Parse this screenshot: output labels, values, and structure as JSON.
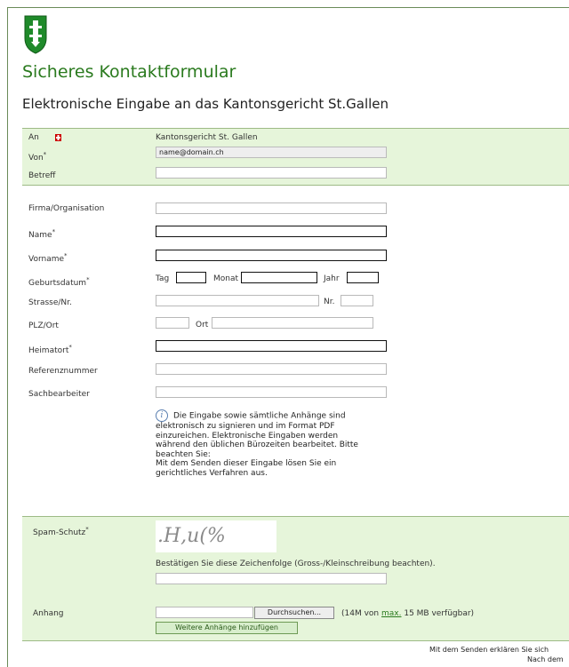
{
  "page": {
    "title": "Sicheres Kontaktformular",
    "subtitle": "Elektronische Eingabe an das Kantonsgericht St.Gallen"
  },
  "header_fields": {
    "an_label": "An",
    "an_value": "Kantonsgericht St. Gallen",
    "von_label": "Von",
    "von_value": "name@domain.ch",
    "betreff_label": "Betreff",
    "betreff_value": ""
  },
  "fields": {
    "firma_label": "Firma/Organisation",
    "name_label": "Name",
    "vorname_label": "Vorname",
    "geburtsdatum_label": "Geburtsdatum",
    "tag_label": "Tag",
    "monat_label": "Monat",
    "jahr_label": "Jahr",
    "strasse_label": "Strasse/Nr.",
    "nr_label": "Nr.",
    "plz_label": "PLZ/Ort",
    "ort_label": "Ort",
    "heimatort_label": "Heimatort",
    "referenz_label": "Referenznummer",
    "sachbearbeiter_label": "Sachbearbeiter",
    "required_mark": "*"
  },
  "info": {
    "lines": [
      "Die Eingabe sowie sämtliche Anhänge sind",
      "elektronisch zu signieren und im Format PDF",
      "einzureichen. Elektronische Eingaben werden",
      "während den üblichen Bürozeiten bearbeitet. Bitte",
      "beachten Sie:",
      "Mit dem Senden dieser Eingabe lösen Sie ein",
      "gerichtliches Verfahren aus."
    ]
  },
  "spam": {
    "label": "Spam-Schutz",
    "captcha_text": ".H,u(%",
    "instruction": "Bestätigen Sie diese Zeichenfolge (Gross-/Kleinschreibung beachten)."
  },
  "attachment": {
    "label": "Anhang",
    "browse_button": "Durchsuchen...",
    "quota_prefix": "(14M von ",
    "quota_link": "max.",
    "quota_suffix": " 15 MB verfügbar)",
    "add_button": "Weitere Anhänge hinzufügen"
  },
  "footer": {
    "line1": "Mit dem Senden erklären Sie sich",
    "line2": "Nach dem"
  },
  "colors": {
    "brand_green": "#2a7a1e",
    "band_bg": "#e6f5da"
  }
}
